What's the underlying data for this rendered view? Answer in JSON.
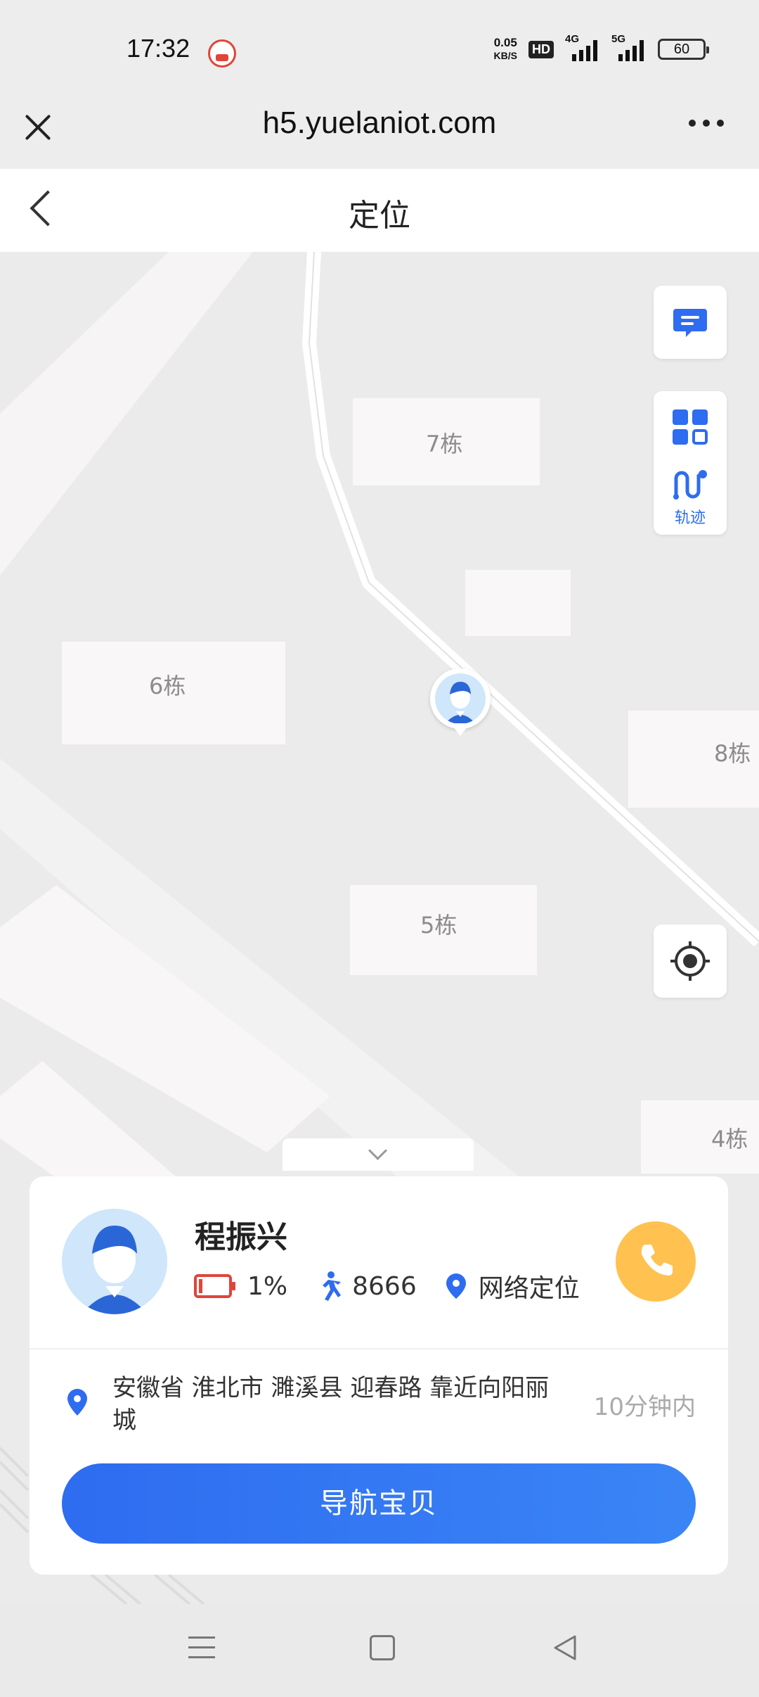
{
  "status_bar": {
    "time": "17:32",
    "net_speed_value": "0.05",
    "net_speed_unit": "KB/S",
    "hd_label": "HD",
    "signal_1_label": "4G",
    "signal_2_label": "5G",
    "battery": "60"
  },
  "browser": {
    "url": "h5.yuelaniot.com",
    "close_icon": "close-icon",
    "more_icon": "more-dots-icon"
  },
  "page": {
    "title": "定位"
  },
  "map": {
    "buildings": [
      "7栋",
      "6栋",
      "8栋",
      "5栋",
      "4栋"
    ],
    "track_label": "轨迹",
    "icons": {
      "message": "message-icon",
      "grid": "grid-icon",
      "track": "track-icon",
      "locate": "locate-icon"
    }
  },
  "card": {
    "name": "程振兴",
    "battery_percent": "1%",
    "steps": "8666",
    "location_type": "网络定位",
    "address": "安徽省 淮北市 濉溪县 迎春路 靠近向阳丽城",
    "time_ago": "10分钟内",
    "navigate_label": "导航宝贝"
  },
  "colors": {
    "accent": "#2e6cf0",
    "call": "#ffc150",
    "battery_low": "#e0453a",
    "map_bg": "#ecebeb"
  }
}
